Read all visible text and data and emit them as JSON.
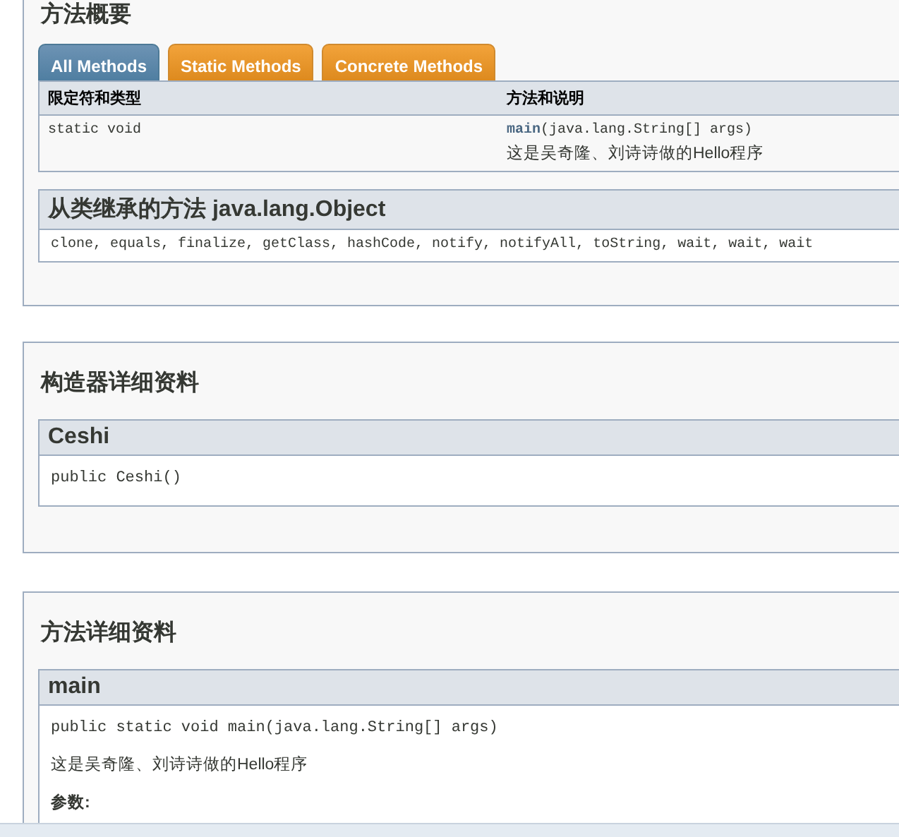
{
  "method_summary": {
    "title": "方法概要",
    "tabs": [
      {
        "label": "All Methods",
        "selected": true
      },
      {
        "label": "Static Methods",
        "selected": false
      },
      {
        "label": "Concrete Methods",
        "selected": false
      }
    ],
    "columns": [
      "限定符和类型",
      "方法和说明"
    ],
    "rows": [
      {
        "modifier": "static void",
        "method": "main",
        "params": "(java.lang.String[] args)",
        "description": "这是吴奇隆、刘诗诗做的Hello程序"
      }
    ],
    "inherited": {
      "title": "从类继承的方法 java.lang.Object",
      "methods": "clone, equals, finalize, getClass, hashCode, notify, notifyAll, toString, wait, wait, wait"
    }
  },
  "constructor_detail": {
    "title": "构造器详细资料",
    "name": "Ceshi",
    "signature": "public Ceshi()"
  },
  "method_detail": {
    "title": "方法详细资料",
    "name": "main",
    "signature": "public static void main(java.lang.String[] args)",
    "description": "这是吴奇隆、刘诗诗做的Hello程序",
    "params_label": "参数:"
  }
}
